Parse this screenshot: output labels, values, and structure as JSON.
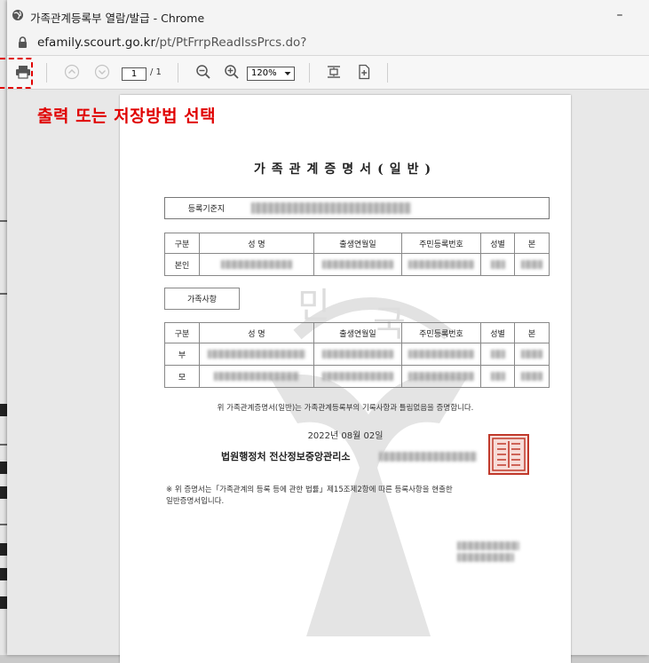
{
  "window": {
    "title": "가족관계등록부 열람/발급 - Chrome",
    "minimize": "–",
    "restore": "☐",
    "url_host": "efamily.scourt.go.kr",
    "url_path": "/pt/PtFrrpReadIssPrcs.do?"
  },
  "toolbar": {
    "page_current": "1",
    "page_total": "/ 1",
    "zoom": "120%"
  },
  "annotation": {
    "text": "출력 또는 저장방법 선택",
    "color": "#e00000"
  },
  "document": {
    "title": "가족관계증명서(일반)",
    "registration_label": "등록기준지",
    "headers": {
      "kind": "구분",
      "name": "성  명",
      "birth": "출생연월일",
      "resident_number": "주민등록번호",
      "gender": "성별",
      "origin": "본"
    },
    "self_label": "본인",
    "family_label": "가족사항",
    "father_label": "부",
    "mother_label": "모",
    "notice": "위 가족관계증명서(일반)는 가족관계등록부의 기록사항과 틀림없음을 증명합니다.",
    "date": "2022년 08월 02일",
    "issuer": "법원행정처 전산정보중앙관리소",
    "footnote_line1": "※ 위 증명서는「가족관계의 등록 등에 관한 법률」제15조제2항에 따른 등록사항을 현출한",
    "footnote_line2": "일반증명서입니다.",
    "watermark": {
      "line_a": "민",
      "line_b": "국"
    }
  }
}
